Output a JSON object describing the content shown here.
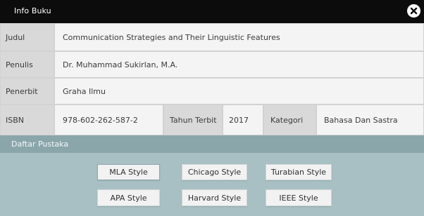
{
  "window": {
    "title": "Info Buku"
  },
  "fields": {
    "judul": {
      "label": "Judul",
      "value": "Communication Strategies and Their Linguistic Features"
    },
    "penulis": {
      "label": "Penulis",
      "value": "Dr. Muhammad Sukirlan, M.A."
    },
    "penerbit": {
      "label": "Penerbit",
      "value": "Graha Ilmu"
    },
    "isbn": {
      "label": "ISBN",
      "value": "978-602-262-587-2"
    },
    "tahun_terbit": {
      "label": "Tahun Terbit",
      "value": "2017"
    },
    "kategori": {
      "label": "Kategori",
      "value": "Bahasa Dan Sastra"
    }
  },
  "daftar_pustaka": {
    "title": "Daftar Pustaka",
    "styles": [
      {
        "label": "MLA Style"
      },
      {
        "label": "Chicago Style"
      },
      {
        "label": "Turabian Style"
      },
      {
        "label": "APA Style"
      },
      {
        "label": "Harvard Style"
      },
      {
        "label": "IEEE Style"
      }
    ]
  },
  "colors": {
    "titlebar": "#0c0c0c",
    "label_bg": "#d9d9d9",
    "value_bg": "#f4f4f4",
    "pustaka_header": "#8aa6ab",
    "pustaka_body": "#a8c0c4"
  },
  "icons": {
    "close": "close-circle-icon"
  }
}
